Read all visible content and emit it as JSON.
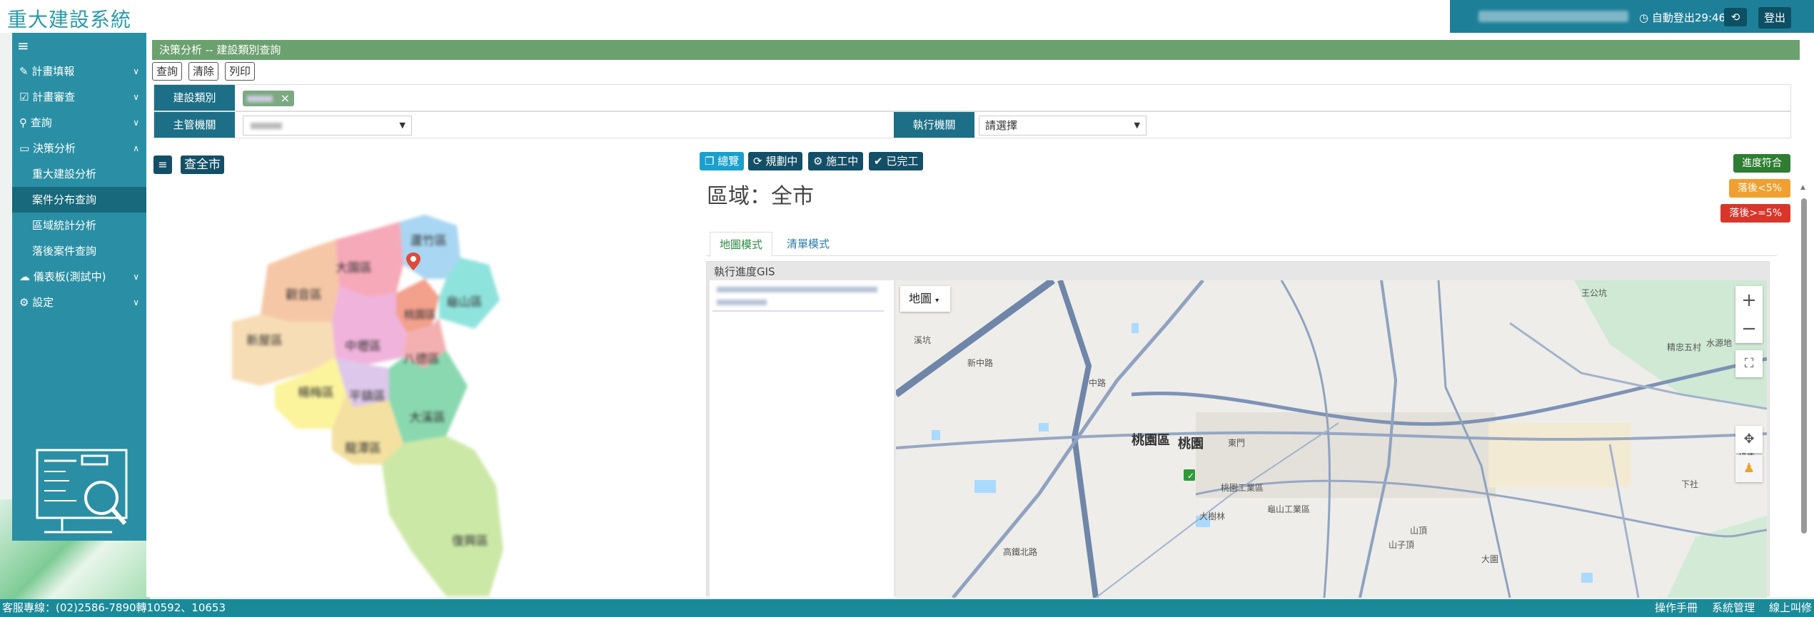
{
  "header": {
    "brand": "重大建設系統",
    "auto_logout": "自動登出29:46",
    "logout_label": "登出"
  },
  "sidebar": {
    "items": [
      {
        "label": "計畫填報",
        "icon": "edit-icon"
      },
      {
        "label": "計畫審查",
        "icon": "check-square-icon"
      },
      {
        "label": "查詢",
        "icon": "search-icon"
      },
      {
        "label": "決策分析",
        "icon": "laptop-icon"
      },
      {
        "label": "重大建設分析"
      },
      {
        "label": "案件分布查詢"
      },
      {
        "label": "區域統計分析"
      },
      {
        "label": "落後案件查詢"
      },
      {
        "label": "儀表板(測試中)",
        "icon": "dashboard-icon"
      },
      {
        "label": "設定",
        "icon": "gear-icon"
      }
    ]
  },
  "page": {
    "title": "決策分析 -- 建設類別查詢",
    "toolbar": {
      "query": "查詢",
      "clear": "清除",
      "print": "列印"
    }
  },
  "filters": {
    "category_label": "建設類別",
    "agency_label": "主管機關",
    "exec_label": "執行機關",
    "exec_value": "請選擇"
  },
  "leftmap": {
    "city_button": "查全市",
    "districts": [
      "蘆竹區",
      "大園區",
      "觀音區",
      "桃園區",
      "龜山區",
      "新屋區",
      "中壢區",
      "八德區",
      "楊梅區",
      "平鎮區",
      "大溪區",
      "龍潭區",
      "復興區"
    ]
  },
  "status_buttons": {
    "overview": "總覽",
    "planning": "規劃中",
    "construction": "施工中",
    "completed": "已完工"
  },
  "region": {
    "title": "區域：全市"
  },
  "tabs": {
    "map": "地圖模式",
    "list": "清單模式"
  },
  "gis": {
    "title": "執行進度GIS",
    "map_type": "地圖",
    "labels": {
      "district": "桃園區",
      "station": "桃園",
      "places": [
        "中路",
        "桃園工業區",
        "龜山工業區",
        "大樹林",
        "東門",
        "新中路",
        "高鐵北路",
        "山頂",
        "山子頂",
        "下社",
        "溪坑",
        "大園",
        "王公坑",
        "精忠五村",
        "水源地",
        "坑尾"
      ]
    }
  },
  "legend": {
    "on_track": "進度符合",
    "behind_small": "落後<5%",
    "behind_large": "落後>=5%",
    "colors": {
      "on_track": "#2e7d32",
      "behind_small": "#f0a030",
      "behind_large": "#d9362b"
    }
  },
  "footer": {
    "hotline": "客服專線：(02)2586-7890轉10592、10653",
    "manual": "操作手冊",
    "admin": "系統管理",
    "online": "線上叫修"
  }
}
